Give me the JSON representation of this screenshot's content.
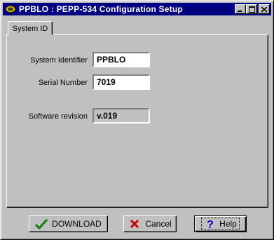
{
  "window": {
    "title": "PPBLO : PEPP-534 Configuration Setup",
    "title_bar_color": "#000080"
  },
  "controls": {
    "minimize_icon": "minimize-icon",
    "maximize_icon": "maximize-icon",
    "close_icon": "close-icon"
  },
  "tabs": [
    {
      "label": "System ID",
      "selected": true
    }
  ],
  "form": {
    "system_identifier": {
      "label": "System Identifier",
      "value": "PPBLO"
    },
    "serial_number": {
      "label": "Serial Number",
      "value": "7019"
    },
    "software_revision": {
      "label": "Software revision",
      "value": "v.019"
    }
  },
  "buttons": {
    "download": {
      "label": "DOWNLOAD",
      "icon": "checkmark-icon",
      "icon_color": "#008000"
    },
    "cancel": {
      "label": "Cancel",
      "icon": "x-icon",
      "icon_color": "#c00000"
    },
    "help": {
      "label": "Help",
      "icon": "question-icon",
      "icon_color": "#0000c0"
    }
  }
}
